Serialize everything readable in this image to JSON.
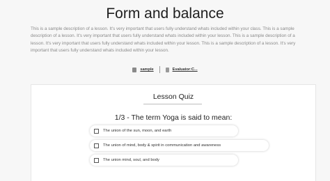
{
  "page": {
    "title": "Form and balance",
    "description": "This is a sample description of a lesson. It's very important that users fully understand whats included within your class. This is a sample description of a lesson. It's very important that users fully understand whats included within your lesson. This is a sample description of a lesson. It's very important that users fully understand whats included within your lesson. This is a sample description of a lesson. It's very important that users fully understand whats included within your lesson."
  },
  "meta": {
    "category_label": "sample",
    "evaluator_label": "Evaluator:C...",
    "category_icon": "tag-icon",
    "evaluator_icon": "document-icon"
  },
  "quiz": {
    "title": "Lesson Quiz",
    "question": "1/3 - The term Yoga is said to mean:",
    "answers": [
      "The union of the sun, moon, and earth",
      "The union of mind, body & spirit in communication and awareness",
      "The union mind, soul, and body"
    ]
  }
}
